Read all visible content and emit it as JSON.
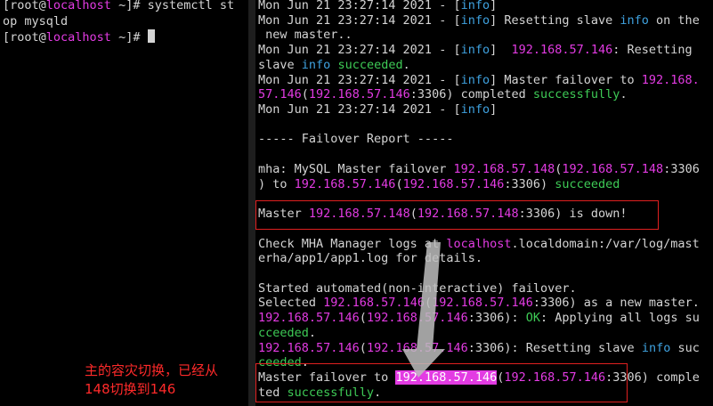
{
  "left_terminal": {
    "lines": [
      [
        {
          "t": "[root@",
          "c": "w"
        },
        {
          "t": "localhost",
          "c": "m"
        },
        {
          "t": " ~]# systemctl st",
          "c": "w"
        }
      ],
      [
        {
          "t": "op mysqld",
          "c": "w"
        }
      ],
      [
        {
          "t": "[root@",
          "c": "w"
        },
        {
          "t": "localhost",
          "c": "m"
        },
        {
          "t": " ~]# ",
          "c": "w"
        }
      ]
    ]
  },
  "right_terminal": {
    "lines": [
      [
        {
          "t": "Mon Jun 21 23:27:14 2021 - [",
          "c": "w"
        },
        {
          "t": "info",
          "c": "c"
        },
        {
          "t": "]",
          "c": "w"
        }
      ],
      [
        {
          "t": "Mon Jun 21 23:27:14 2021 - [",
          "c": "w"
        },
        {
          "t": "info",
          "c": "c"
        },
        {
          "t": "] Resetting slave ",
          "c": "w"
        },
        {
          "t": "info",
          "c": "c"
        },
        {
          "t": " on the",
          "c": "w"
        }
      ],
      [
        {
          "t": " new master..",
          "c": "w"
        }
      ],
      [
        {
          "t": "Mon Jun 21 23:27:14 2021 - [",
          "c": "w"
        },
        {
          "t": "info",
          "c": "c"
        },
        {
          "t": "]  ",
          "c": "w"
        },
        {
          "t": "192.168.57.146",
          "c": "m"
        },
        {
          "t": ": Resetting",
          "c": "w"
        }
      ],
      [
        {
          "t": "slave ",
          "c": "w"
        },
        {
          "t": "info",
          "c": "c"
        },
        {
          "t": " ",
          "c": "w"
        },
        {
          "t": "succeeded",
          "c": "g"
        },
        {
          "t": ".",
          "c": "w"
        }
      ],
      [
        {
          "t": "Mon Jun 21 23:27:14 2021 - [",
          "c": "w"
        },
        {
          "t": "info",
          "c": "c"
        },
        {
          "t": "] Master failover to ",
          "c": "w"
        },
        {
          "t": "192.168.",
          "c": "m"
        }
      ],
      [
        {
          "t": "57.146",
          "c": "m"
        },
        {
          "t": "(",
          "c": "w"
        },
        {
          "t": "192.168.57.146",
          "c": "m"
        },
        {
          "t": ":3306) completed ",
          "c": "w"
        },
        {
          "t": "successfully",
          "c": "g"
        },
        {
          "t": ".",
          "c": "w"
        }
      ],
      [
        {
          "t": "Mon Jun 21 23:27:14 2021 - [",
          "c": "w"
        },
        {
          "t": "info",
          "c": "c"
        },
        {
          "t": "]",
          "c": "w"
        }
      ],
      [
        {
          "t": "",
          "c": "w"
        }
      ],
      [
        {
          "t": "----- Failover Report -----",
          "c": "w"
        }
      ],
      [
        {
          "t": "",
          "c": "w"
        }
      ],
      [
        {
          "t": "mha: MySQL Master failover ",
          "c": "w"
        },
        {
          "t": "192.168.57.148",
          "c": "m"
        },
        {
          "t": "(",
          "c": "w"
        },
        {
          "t": "192.168.57.148",
          "c": "m"
        },
        {
          "t": ":3306",
          "c": "w"
        }
      ],
      [
        {
          "t": ") to ",
          "c": "w"
        },
        {
          "t": "192.168.57.146",
          "c": "m"
        },
        {
          "t": "(",
          "c": "w"
        },
        {
          "t": "192.168.57.146",
          "c": "m"
        },
        {
          "t": ":3306) ",
          "c": "w"
        },
        {
          "t": "succeeded",
          "c": "g"
        }
      ],
      [
        {
          "t": "",
          "c": "w"
        }
      ],
      [
        {
          "t": "Master ",
          "c": "w"
        },
        {
          "t": "192.168.57.148",
          "c": "m"
        },
        {
          "t": "(",
          "c": "w"
        },
        {
          "t": "192.168.57.148",
          "c": "m"
        },
        {
          "t": ":3306) is down!",
          "c": "w"
        }
      ],
      [
        {
          "t": "",
          "c": "w"
        }
      ],
      [
        {
          "t": "Check MHA Manager logs at ",
          "c": "w"
        },
        {
          "t": "localhost",
          "c": "m"
        },
        {
          "t": ".localdomain:/var/log/mast",
          "c": "w"
        }
      ],
      [
        {
          "t": "erha/app1/app1.log for details.",
          "c": "w"
        }
      ],
      [
        {
          "t": "",
          "c": "w"
        }
      ],
      [
        {
          "t": "Started automated(non-interactive) failover.",
          "c": "w"
        }
      ],
      [
        {
          "t": "Selected ",
          "c": "w"
        },
        {
          "t": "192.168.57.146",
          "c": "m"
        },
        {
          "t": "(",
          "c": "w"
        },
        {
          "t": "192.168.57.146",
          "c": "m"
        },
        {
          "t": ":3306) as a new master.",
          "c": "w"
        }
      ],
      [
        {
          "t": "192.168.57.146",
          "c": "m"
        },
        {
          "t": "(",
          "c": "w"
        },
        {
          "t": "192.168.57.146",
          "c": "m"
        },
        {
          "t": ":3306): ",
          "c": "w"
        },
        {
          "t": "OK",
          "c": "g"
        },
        {
          "t": ": Applying all logs su",
          "c": "w"
        }
      ],
      [
        {
          "t": "cceeded",
          "c": "g"
        },
        {
          "t": ".",
          "c": "w"
        }
      ],
      [
        {
          "t": "192.168.57.146",
          "c": "m"
        },
        {
          "t": "(",
          "c": "w"
        },
        {
          "t": "192.168.57.146",
          "c": "m"
        },
        {
          "t": ":3306): Resetting slave ",
          "c": "w"
        },
        {
          "t": "info",
          "c": "c"
        },
        {
          "t": " suc",
          "c": "w"
        }
      ],
      [
        {
          "t": "ceeded",
          "c": "g"
        },
        {
          "t": ".",
          "c": "w"
        }
      ],
      [
        {
          "t": "Master failover to ",
          "c": "w"
        },
        {
          "t": "192.168.57.146",
          "c": "hl"
        },
        {
          "t": "(",
          "c": "w"
        },
        {
          "t": "192.168.57.146",
          "c": "m"
        },
        {
          "t": ":3306) comple",
          "c": "w"
        }
      ],
      [
        {
          "t": "ted ",
          "c": "w"
        },
        {
          "t": "successfully",
          "c": "g"
        },
        {
          "t": ".",
          "c": "w"
        }
      ]
    ]
  },
  "annotation": {
    "line1": "主的容灾切换，已经从",
    "line2": "148切换到146"
  },
  "colors": {
    "background": "#000000",
    "text": "#d4d4d4",
    "magenta": "#e33be3",
    "cyan": "#3fa2e0",
    "green": "#3ecb56",
    "annotation_red": "#ff2a2a"
  }
}
